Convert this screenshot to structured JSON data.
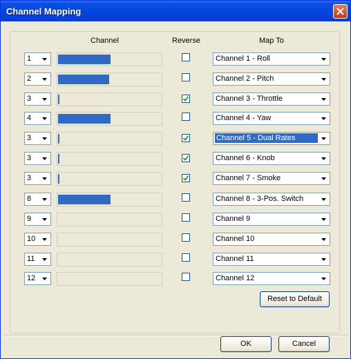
{
  "window": {
    "title": "Channel Mapping"
  },
  "headers": {
    "channel": "Channel",
    "reverse": "Reverse",
    "map_to": "Map To"
  },
  "rows": [
    {
      "src": "1",
      "level": 0.5,
      "reverse": false,
      "map": "Channel 1 - Roll"
    },
    {
      "src": "2",
      "level": 0.49,
      "reverse": false,
      "map": "Channel 2 - Pitch"
    },
    {
      "src": "3",
      "level": 0.01,
      "reverse": true,
      "map": "Channel 3 - Throttle"
    },
    {
      "src": "4",
      "level": 0.5,
      "reverse": false,
      "map": "Channel 4 - Yaw"
    },
    {
      "src": "3",
      "level": 0.01,
      "reverse": true,
      "map": "Channel 5 - Dual Rates",
      "selected": true
    },
    {
      "src": "3",
      "level": 0.01,
      "reverse": true,
      "map": "Channel 6 - Knob"
    },
    {
      "src": "3",
      "level": 0.01,
      "reverse": true,
      "map": "Channel 7 - Smoke"
    },
    {
      "src": "8",
      "level": 0.5,
      "reverse": false,
      "map": "Channel 8 - 3-Pos. Switch"
    },
    {
      "src": "9",
      "level": 0,
      "reverse": false,
      "map": "Channel 9"
    },
    {
      "src": "10",
      "level": 0,
      "reverse": false,
      "map": "Channel 10"
    },
    {
      "src": "11",
      "level": 0,
      "reverse": false,
      "map": "Channel 11"
    },
    {
      "src": "12",
      "level": 0,
      "reverse": false,
      "map": "Channel 12"
    }
  ],
  "buttons": {
    "reset": "Reset to Default",
    "ok": "OK",
    "cancel": "Cancel"
  },
  "colors": {
    "accent": "#316ac5",
    "title_bar": "#0343d9",
    "face": "#ece9d8"
  }
}
